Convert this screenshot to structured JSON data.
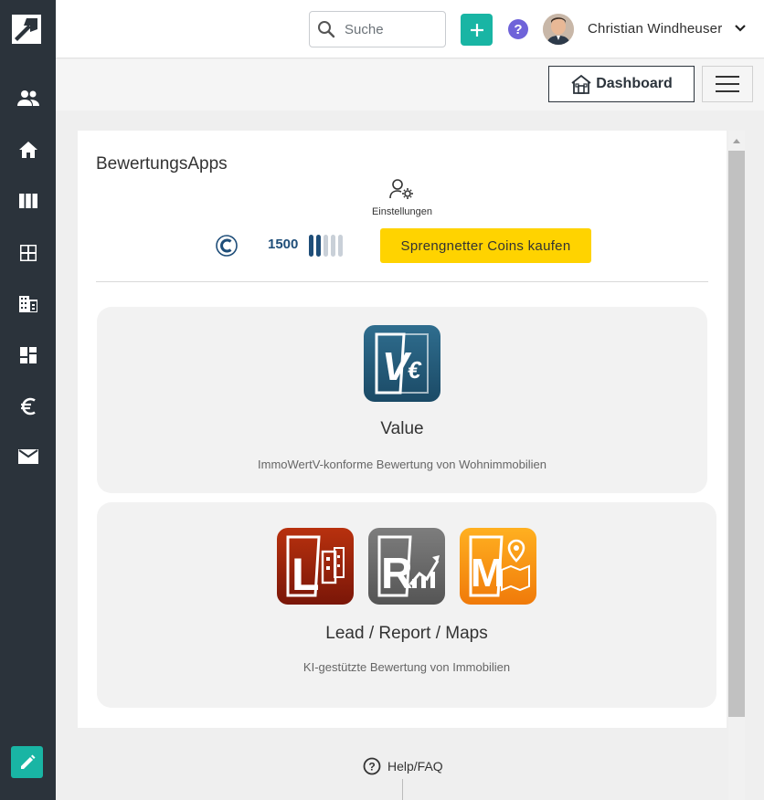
{
  "search": {
    "placeholder": "Suche"
  },
  "header": {
    "user_name": "Christian Windheuser",
    "help_label": "?"
  },
  "subbar": {
    "dashboard_label": "Dashboard"
  },
  "sidebar": {
    "items": [
      {
        "icon": "people-icon"
      },
      {
        "icon": "home-icon"
      },
      {
        "icon": "columns-icon"
      },
      {
        "icon": "grid-icon"
      },
      {
        "icon": "building-icon"
      },
      {
        "icon": "dashboard-icon"
      },
      {
        "icon": "euro-icon"
      },
      {
        "icon": "mail-icon"
      }
    ],
    "edit_icon": "edit-icon"
  },
  "card": {
    "title": "BewertungsApps",
    "settings_label": "Einstellungen",
    "coins": {
      "count": "1500",
      "buy_label": "Sprengnetter Coins kaufen"
    },
    "tiles": [
      {
        "title": "Value",
        "description": "ImmoWertV-konforme Bewertung von Wohnimmobilien",
        "icon_letters": [
          "V€"
        ]
      },
      {
        "title": "Lead / Report / Maps",
        "description": "KI-gestützte Bewertung von Immobilien",
        "icon_letters": [
          "L",
          "R",
          "M"
        ]
      }
    ]
  },
  "footer": {
    "help_label": "Help/FAQ"
  },
  "colors": {
    "sidebar": "#2b333b",
    "accent": "#19b5a4",
    "coin_button": "#ffd300",
    "help": "#6f63d9",
    "coin_text": "#1f4e79"
  }
}
